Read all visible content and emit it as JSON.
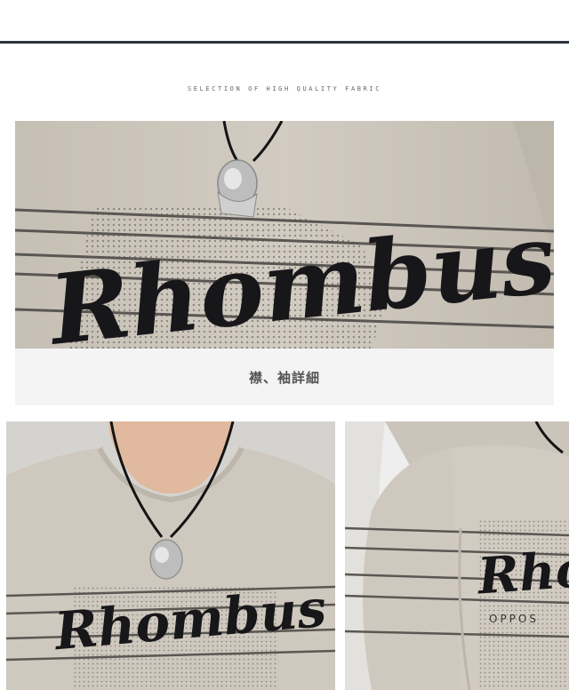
{
  "header": {
    "tagline": "SELECTION OF HIGH QUALITY FABRIC"
  },
  "detail_caption": "襟、袖詳細",
  "shirt": {
    "print_text": "Rhombus",
    "sub_print_text": "OPPOS"
  },
  "colors": {
    "shirt": "#cfc8be",
    "stripe": "#5a5753",
    "script": "#17171a",
    "dots": "#6d6a66",
    "caption_band": "#f4f4f4",
    "cord": "#141414",
    "pendant": "#bdbdbd"
  },
  "images": [
    {
      "name": "chest-closeup-photo",
      "subject": "t-shirt chest print with pendant necklace"
    },
    {
      "name": "collar-front-photo",
      "subject": "model wearing t-shirt, crew neck collar"
    },
    {
      "name": "sleeve-side-photo",
      "subject": "t-shirt sleeve detail, side view"
    }
  ]
}
